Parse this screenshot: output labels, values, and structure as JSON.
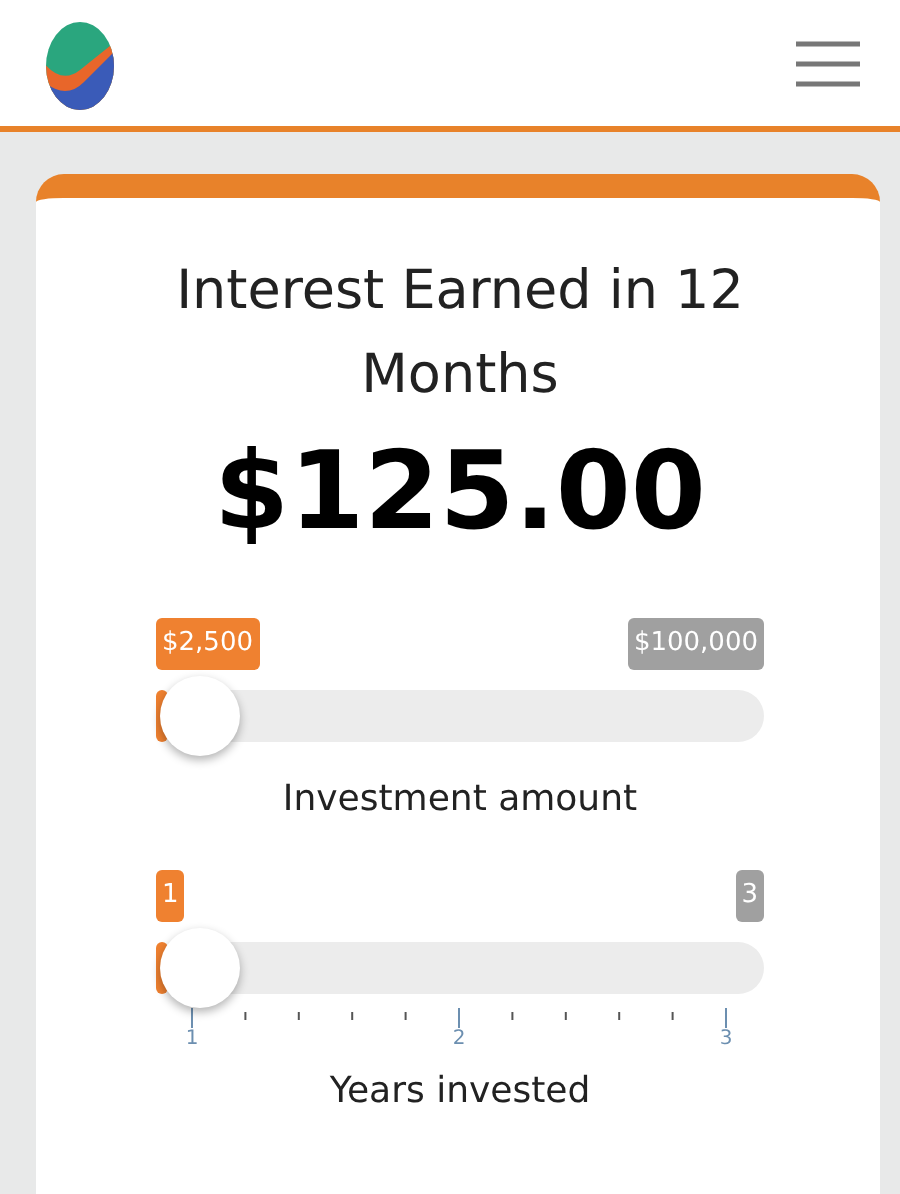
{
  "card": {
    "title": "Interest Earned in 12 Months",
    "amount": "$125.00"
  },
  "sliders": [
    {
      "kind": "plain",
      "min_label": "$2,500",
      "max_label": "$100,000",
      "level": 0,
      "caption": "Investment amount"
    },
    {
      "kind": "ticked",
      "min_label": "1",
      "max_label": "3",
      "level": 0,
      "caption": "Years invested",
      "tick_labels": [
        "1",
        "2",
        "3"
      ]
    }
  ]
}
